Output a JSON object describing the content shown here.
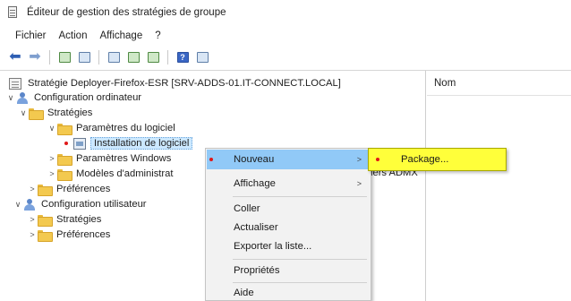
{
  "window": {
    "title": "Éditeur de gestion des stratégies de groupe"
  },
  "menubar": [
    "Fichier",
    "Action",
    "Affichage",
    "?"
  ],
  "toolbar": {
    "icons": [
      "back-arrow-icon",
      "forward-arrow-icon",
      "up-folder-icon",
      "show-hide-tree-icon",
      "properties-icon",
      "refresh-icon",
      "export-list-icon",
      "help-icon",
      "details-view-icon"
    ]
  },
  "tree": {
    "root": "Stratégie Deployer-Firefox-ESR [SRV-ADDS-01.IT-CONNECT.LOCAL]",
    "computer_config": "Configuration ordinateur",
    "strategies": "Stratégies",
    "software_settings": "Paramètres du logiciel",
    "software_installation": "Installation de logiciel",
    "windows_settings": "Paramètres Windows",
    "admin_templates": "Modèles d'administrat",
    "preferences": "Préférences",
    "user_config": "Configuration utilisateur",
    "user_strategies": "Stratégies",
    "user_preferences": "Préférences",
    "overflow_text": "iers ADMX"
  },
  "right_pane": {
    "column_header": "Nom"
  },
  "context_menu": {
    "new": "Nouveau",
    "view": "Affichage",
    "paste": "Coller",
    "refresh": "Actualiser",
    "export": "Exporter la liste...",
    "properties": "Propriétés",
    "help": "Aide"
  },
  "submenu": {
    "package": "Package..."
  },
  "colors": {
    "highlight": "#91c9f7",
    "submenu_bg": "#ffff3a",
    "annotation_dot": "#e01818"
  }
}
